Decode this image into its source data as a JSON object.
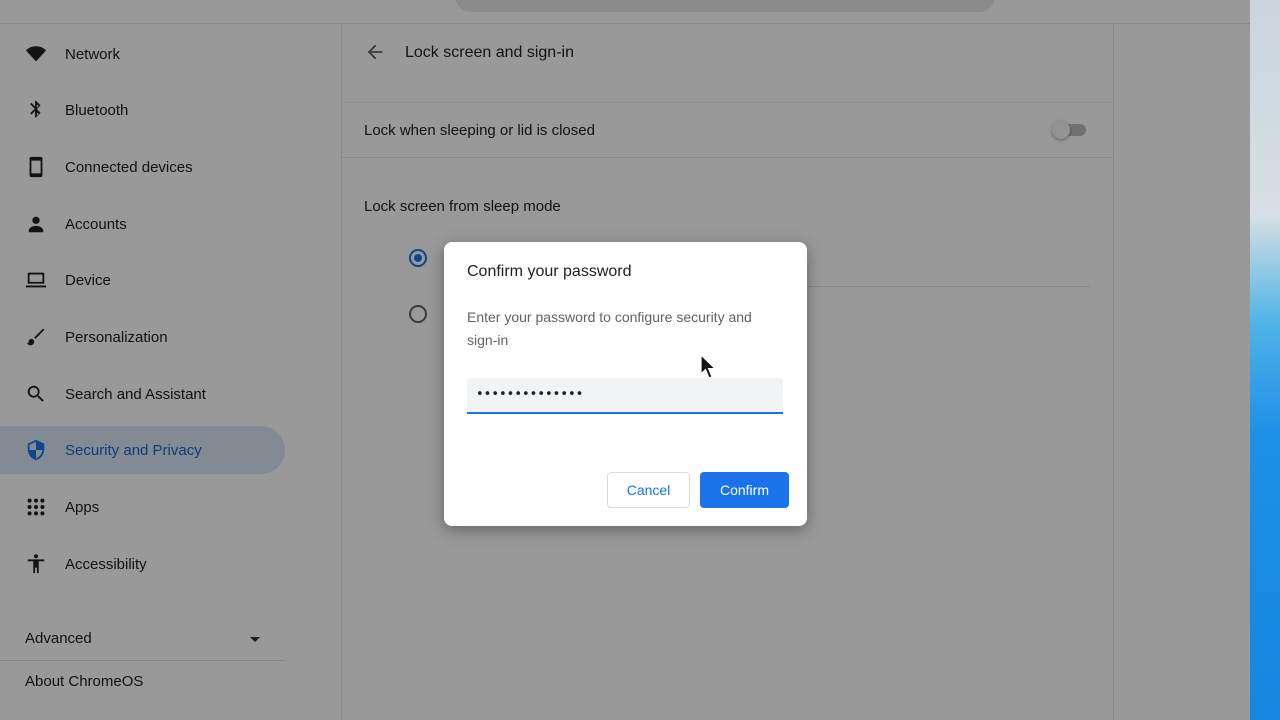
{
  "sidebar": {
    "items": [
      {
        "label": "Network",
        "icon": "wifi-icon"
      },
      {
        "label": "Bluetooth",
        "icon": "bluetooth-icon"
      },
      {
        "label": "Connected devices",
        "icon": "phone-icon"
      },
      {
        "label": "Accounts",
        "icon": "person-icon"
      },
      {
        "label": "Device",
        "icon": "laptop-icon"
      },
      {
        "label": "Personalization",
        "icon": "brush-icon"
      },
      {
        "label": "Search and Assistant",
        "icon": "search-icon"
      },
      {
        "label": "Security and Privacy",
        "icon": "shield-icon",
        "active": true
      },
      {
        "label": "Apps",
        "icon": "apps-grid-icon"
      },
      {
        "label": "Accessibility",
        "icon": "accessibility-icon"
      }
    ],
    "advanced_label": "Advanced",
    "about_label": "About ChromeOS"
  },
  "main": {
    "page_title": "Lock screen and sign-in",
    "lock_row_label": "Lock when sleeping or lid is closed",
    "lock_toggle_on": false,
    "section_label": "Lock screen from sleep mode",
    "radio_selected_index": 0
  },
  "dialog": {
    "title": "Confirm your password",
    "body": "Enter your password to configure security and sign-in",
    "password_value": "••••••••••••••",
    "cancel_label": "Cancel",
    "confirm_label": "Confirm"
  },
  "colors": {
    "accent": "#1a73e8",
    "active_nav_bg": "#d9e6f6"
  }
}
